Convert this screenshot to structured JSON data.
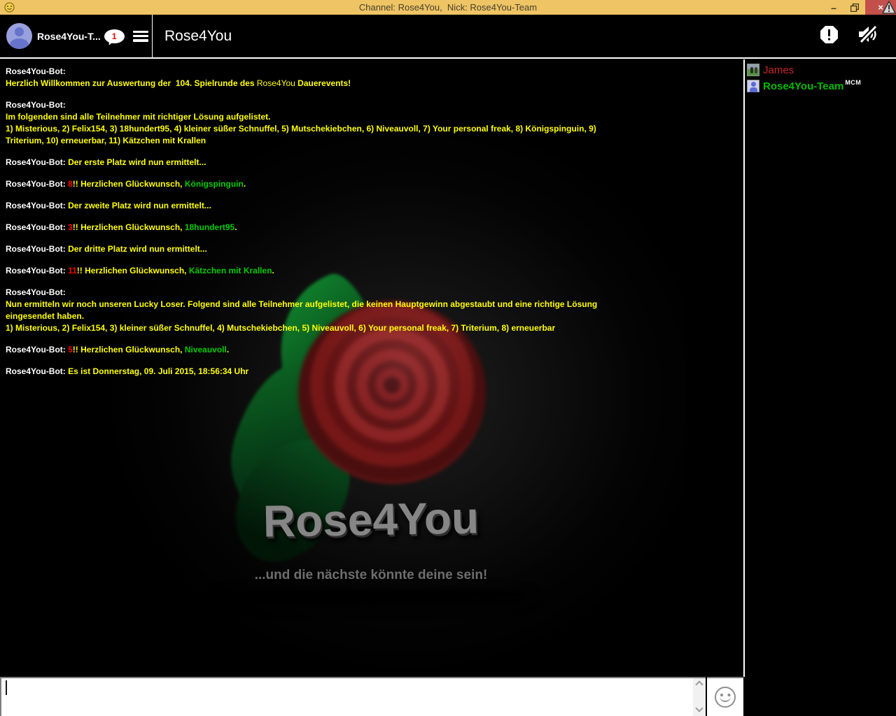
{
  "window": {
    "title": "Channel: Rose4You,  Nick: Rose4You-Team",
    "controls": {
      "minimize": "–",
      "close": "×"
    }
  },
  "header": {
    "self_name": "Rose4You-T...",
    "unread_count": "1",
    "channel_title": "Rose4You"
  },
  "chat": {
    "colors": {
      "white": "#ffffff",
      "yellow": "#ffff00",
      "red": "#ff0000",
      "green": "#00cc00"
    },
    "messages": [
      [
        {
          "t": "Rose4You-Bot:",
          "c": "white"
        },
        {
          "br": true
        },
        {
          "t": "Herzlich Willkommen zur Auswertung der  104. Spielrunde des ",
          "c": "yellow"
        },
        {
          "t": "Rose4You",
          "c": "yellow",
          "thin": true
        },
        {
          "t": " Dauerevents!",
          "c": "yellow"
        }
      ],
      [
        {
          "t": "Rose4You-Bot:",
          "c": "white"
        },
        {
          "br": true
        },
        {
          "t": "Im folgenden sind alle Teilnehmer mit richtiger Lösung aufgelistet.",
          "c": "yellow"
        },
        {
          "br": true
        },
        {
          "t": "1) Misterious, 2) Felix154, 3) 18hundert95, 4) kleiner süßer Schnuffel, 5) Mutschekiebchen, 6) Niveauvoll, 7) Your personal freak, 8) Königspinguin, 9)",
          "c": "yellow"
        },
        {
          "br": true
        },
        {
          "t": "Triterium, 10) erneuerbar, 11) Kätzchen mit Krallen",
          "c": "yellow"
        }
      ],
      [
        {
          "t": "Rose4You-Bot: ",
          "c": "white"
        },
        {
          "t": "Der erste Platz wird nun ermittelt...",
          "c": "yellow"
        }
      ],
      [
        {
          "t": "Rose4You-Bot: ",
          "c": "white"
        },
        {
          "t": "8",
          "c": "red"
        },
        {
          "t": "!! Herzlichen Glückwunsch, ",
          "c": "yellow"
        },
        {
          "t": "Königspinguin",
          "c": "green"
        },
        {
          "t": ".",
          "c": "yellow"
        }
      ],
      [
        {
          "t": "Rose4You-Bot: ",
          "c": "white"
        },
        {
          "t": "Der zweite Platz wird nun ermittelt...",
          "c": "yellow"
        }
      ],
      [
        {
          "t": "Rose4You-Bot: ",
          "c": "white"
        },
        {
          "t": "3",
          "c": "red"
        },
        {
          "t": "!! Herzlichen Glückwunsch, ",
          "c": "yellow"
        },
        {
          "t": "18hundert95",
          "c": "green"
        },
        {
          "t": ".",
          "c": "yellow"
        }
      ],
      [
        {
          "t": "Rose4You-Bot: ",
          "c": "white"
        },
        {
          "t": "Der dritte Platz wird nun ermittelt...",
          "c": "yellow"
        }
      ],
      [
        {
          "t": "Rose4You-Bot: ",
          "c": "white"
        },
        {
          "t": "11",
          "c": "red"
        },
        {
          "t": "!! Herzlichen Glückwunsch, ",
          "c": "yellow"
        },
        {
          "t": "Kätzchen mit Krallen",
          "c": "green"
        },
        {
          "t": ".",
          "c": "yellow"
        }
      ],
      [
        {
          "t": "Rose4You-Bot:",
          "c": "white"
        },
        {
          "br": true
        },
        {
          "t": "Nun ermitteln wir noch unseren Lucky Loser. Folgend sind alle Teilnehmer aufgelistet, die keinen Hauptgewinn abgestaubt und eine richtige Lösung",
          "c": "yellow"
        },
        {
          "br": true
        },
        {
          "t": "eingesendet haben.",
          "c": "yellow"
        },
        {
          "br": true
        },
        {
          "t": "1) Misterious, 2) Felix154, 3) kleiner süßer Schnuffel, 4) Mutschekiebchen, 5) Niveauvoll, 6) Your personal freak, 7) Triterium, 8) erneuerbar",
          "c": "yellow"
        }
      ],
      [
        {
          "t": "Rose4You-Bot: ",
          "c": "white"
        },
        {
          "t": "5",
          "c": "red"
        },
        {
          "t": "!! Herzlichen Glückwunsch, ",
          "c": "yellow"
        },
        {
          "t": "Niveauvoll",
          "c": "green"
        },
        {
          "t": ".",
          "c": "yellow"
        }
      ],
      [
        {
          "t": "Rose4You-Bot: ",
          "c": "white"
        },
        {
          "t": "Es ist Donnerstag, 09. Juli 2015, 18:56:34 Uhr",
          "c": "yellow"
        }
      ]
    ]
  },
  "background": {
    "logo": "Rose4You",
    "tagline": "...und die nächste könnte deine sein!"
  },
  "sidebar": {
    "users": [
      {
        "name": "James",
        "color": "#cc2626",
        "bold": false,
        "avatar": "photo",
        "badge": ""
      },
      {
        "name": "Rose4You-Team",
        "color": "#00bb00",
        "bold": true,
        "avatar": "person",
        "badge": "MCM"
      }
    ]
  },
  "composer": {
    "value": ""
  }
}
